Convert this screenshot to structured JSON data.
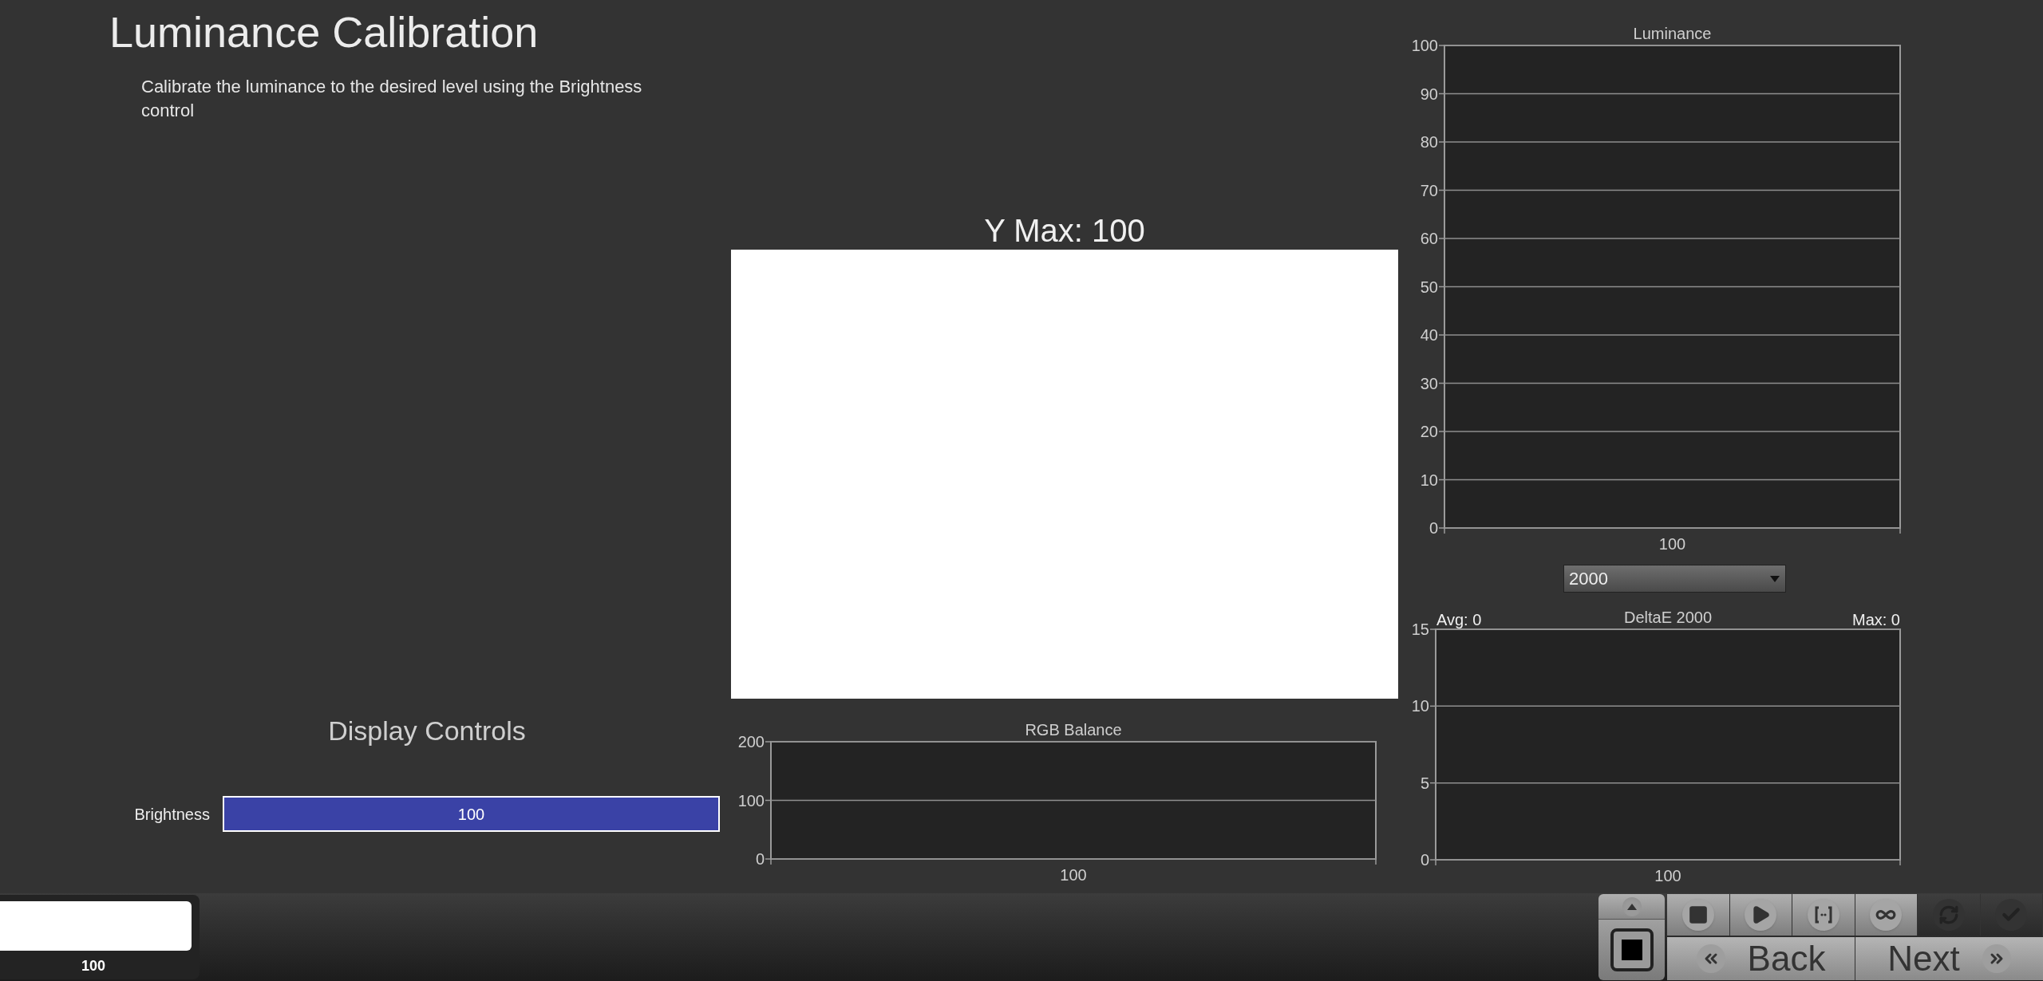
{
  "page": {
    "title": "Luminance Calibration",
    "instructions": "Calibrate the luminance to the desired level using the Brightness control"
  },
  "patch": {
    "heading": "Y Max: 100"
  },
  "display_controls": {
    "title": "Display Controls",
    "controls": [
      {
        "label": "Brightness",
        "value": "100",
        "level": 1
      }
    ]
  },
  "luminance_chart": {
    "chart_data": {
      "type": "line",
      "title": "Luminance",
      "grid": true,
      "categories": [
        "100"
      ],
      "ylim": [
        0,
        100
      ],
      "yticks": [
        0,
        10,
        20,
        30,
        40,
        50,
        60,
        70,
        80,
        90,
        100
      ]
    }
  },
  "deltae_selector": {
    "value": "2000"
  },
  "deltae_chart": {
    "avg": "Avg: 0",
    "max": "Max: 0",
    "chart_data": {
      "type": "line",
      "title": "DeltaE 2000",
      "grid": true,
      "categories": [
        "100"
      ],
      "ylim": [
        0,
        15
      ],
      "yticks": [
        0,
        5,
        10,
        15
      ]
    }
  },
  "rgb_chart": {
    "chart_data": {
      "type": "line",
      "title": "RGB Balance",
      "grid": true,
      "categories": [
        "100"
      ],
      "ylim": [
        0,
        200
      ],
      "yticks": [
        0,
        100,
        200
      ]
    }
  },
  "preview": {
    "reading": "100"
  },
  "toolbar": {
    "side_buttons": [
      {
        "kind": "up"
      },
      {
        "kind": "stop_large"
      }
    ],
    "buttons": [
      {
        "kind": "stop",
        "disabled": false
      },
      {
        "kind": "play",
        "disabled": false
      },
      {
        "kind": "brackets",
        "disabled": false
      },
      {
        "kind": "loop",
        "disabled": false
      },
      {
        "kind": "refresh",
        "disabled": true
      },
      {
        "kind": "check",
        "disabled": true
      }
    ],
    "back": "Back",
    "next": "Next"
  }
}
